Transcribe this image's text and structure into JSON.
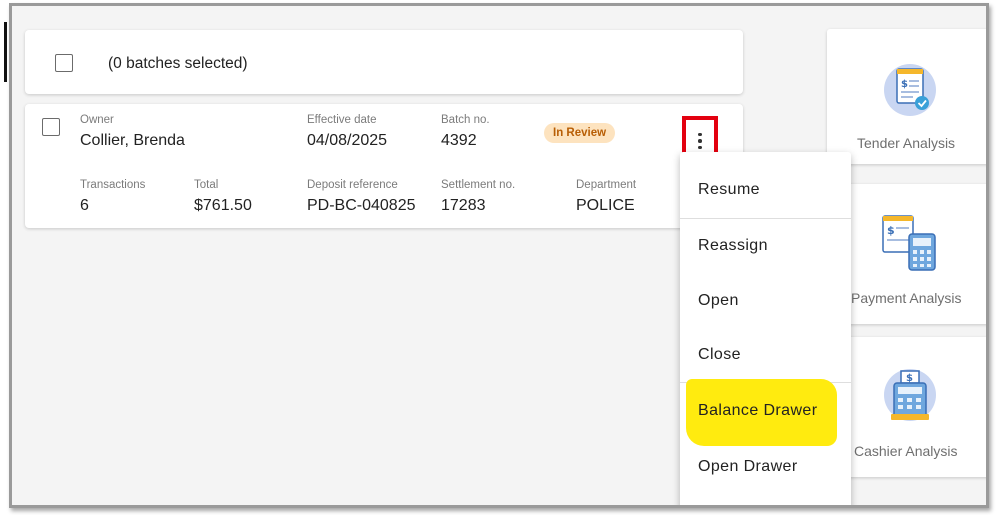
{
  "header": {
    "selection_text": "(0 batches selected)"
  },
  "batch": {
    "owner_label": "Owner",
    "owner": "Collier, Brenda",
    "effective_date_label": "Effective date",
    "effective_date": "04/08/2025",
    "batch_no_label": "Batch no.",
    "batch_no": "4392",
    "status": "In Review",
    "transactions_label": "Transactions",
    "transactions": "6",
    "total_label": "Total",
    "total": "$761.50",
    "deposit_reference_label": "Deposit reference",
    "deposit_reference": "PD-BC-040825",
    "settlement_no_label": "Settlement no.",
    "settlement_no": "17283",
    "department_label": "Department",
    "department": "POLICE"
  },
  "menu": {
    "items": [
      {
        "label": "Resume"
      },
      {
        "label": "Reassign"
      },
      {
        "label": "Open"
      },
      {
        "label": "Close"
      },
      {
        "label": "Balance Drawer",
        "highlighted": true
      },
      {
        "label": "Open Drawer"
      }
    ]
  },
  "analysis": {
    "items": [
      {
        "label": "Tender Analysis",
        "icon": "tender-analysis-icon"
      },
      {
        "label": "Payment Analysis",
        "icon": "payment-analysis-icon"
      },
      {
        "label": "Cashier Analysis",
        "icon": "cashier-analysis-icon"
      }
    ]
  },
  "colors": {
    "status_bg": "#fde3bf",
    "status_text": "#b85e05",
    "callout_border": "#e3000f",
    "highlight": "#ffeb0f"
  }
}
